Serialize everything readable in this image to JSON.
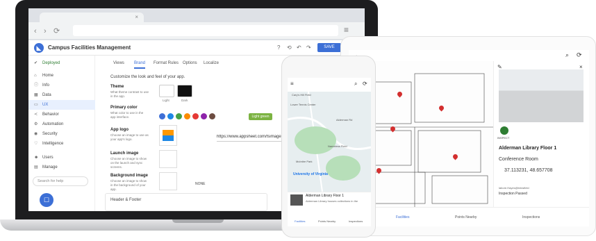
{
  "browser": {
    "back_icon": "chevron-left-icon",
    "forward_icon": "chevron-right-icon",
    "reload_icon": "reload-icon",
    "menu_icon": "hamburger-icon"
  },
  "app": {
    "title": "Campus Facilities Management",
    "save_label": "SAVE",
    "accent": "#3c6fd6"
  },
  "sidebar": {
    "status": "Deployed",
    "items": [
      {
        "label": "Home",
        "icon": "home-icon"
      },
      {
        "label": "Info",
        "icon": "info-icon"
      },
      {
        "label": "Data",
        "icon": "data-icon"
      },
      {
        "label": "UX",
        "icon": "ux-icon"
      },
      {
        "label": "Behavior",
        "icon": "behavior-icon"
      },
      {
        "label": "Automation",
        "icon": "automation-icon"
      },
      {
        "label": "Security",
        "icon": "security-icon"
      },
      {
        "label": "Intelligence",
        "icon": "intelligence-icon"
      },
      {
        "label": "Users",
        "icon": "users-icon"
      },
      {
        "label": "Manage",
        "icon": "manage-icon"
      }
    ],
    "search_placeholder": "Search for help"
  },
  "tabs": [
    "Views",
    "Brand",
    "Format Rules",
    "Options",
    "Localize"
  ],
  "brand": {
    "intro": "Customize the look and feel of your app.",
    "theme": {
      "title": "Theme",
      "desc": "What theme contrast to use in the app.",
      "options": [
        "Light",
        "Dark"
      ]
    },
    "primary_color": {
      "title": "Primary color",
      "desc": "What color to use in the app interface.",
      "swatches": [
        "#3f6fd6",
        "#1e88e5",
        "#43a047",
        "#fb8c00",
        "#e53935",
        "#8e24aa",
        "#6d4c41",
        "#7cb342"
      ],
      "selected": "Light green"
    },
    "app_logo": {
      "title": "App logo",
      "desc": "Choose an image to use as your app's logo.",
      "url": "https://www.appsheet.com/fsimage.pr"
    },
    "launch_image": {
      "title": "Launch image",
      "desc": "Choose an image to show on the launch and sync screens."
    },
    "background_image": {
      "title": "Background image",
      "desc": "Choose an image to show in the background of your app.",
      "value": "NONE"
    },
    "header_footer": "Header & Footer"
  },
  "phone": {
    "card_title": "Alderman Library Floor 1",
    "card_desc": "Alderman Library houses collections in the",
    "nav": [
      "Facilities",
      "Points Nearby",
      "Inspections"
    ],
    "map_labels": [
      "Cary's Hill Field",
      "Lower Tennis Center",
      "Alderman Rd",
      "University of Virginia",
      "McIntire Park",
      "Nameless Field"
    ]
  },
  "tablet": {
    "detail": {
      "action_label": "INSPECT",
      "title": "Alderman Library Floor 1",
      "subtitle": "Conference Room",
      "coords": "37.113231, 48.657708",
      "owner": "labore.Hayes@brinsfield",
      "status": "Inspection Passed"
    },
    "nav": [
      "Facilities",
      "Points Nearby",
      "Inspections"
    ]
  }
}
